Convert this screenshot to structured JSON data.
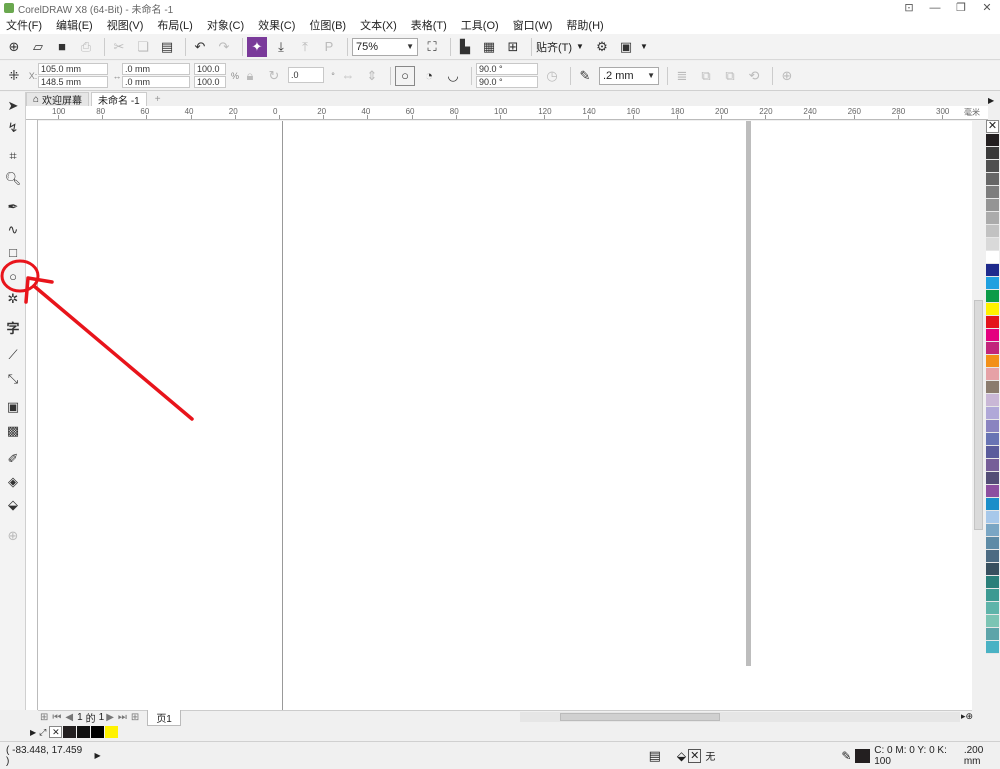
{
  "window": {
    "title": "CorelDRAW X8 (64-Bit) - 未命名 -1"
  },
  "menu": [
    "文件(F)",
    "编辑(E)",
    "视图(V)",
    "布局(L)",
    "对象(C)",
    "效果(C)",
    "位图(B)",
    "文本(X)",
    "表格(T)",
    "工具(O)",
    "窗口(W)",
    "帮助(H)"
  ],
  "standard_toolbar": {
    "zoom_value": "75%",
    "snap_label": "贴齐(T)"
  },
  "property_bar": {
    "x": "105.0 mm",
    "y": "148.5 mm",
    "width": ".0 mm",
    "height": ".0 mm",
    "scale_x": "100.0",
    "scale_y": "100.0",
    "percent": "%",
    "rotation": ".0",
    "angle_start": "90.0 °",
    "angle_end": "90.0 °",
    "outline_width": ".2 mm"
  },
  "tabs": {
    "welcome": "欢迎屏幕",
    "document": "未命名 -1"
  },
  "ruler": {
    "h_labels": [
      "100",
      "80",
      "60",
      "40",
      "20",
      "0",
      "20",
      "40",
      "60",
      "80",
      "100",
      "120",
      "140",
      "160",
      "180",
      "200",
      "220",
      "240",
      "260",
      "280",
      "300"
    ],
    "unit": "毫米"
  },
  "page_nav": {
    "current": "1",
    "of_label": "的",
    "total": "1",
    "page_tab": "页1"
  },
  "status": {
    "coords": "( -83.448, 17.459 )",
    "fill_label": "无",
    "outline_color": "C: 0 M: 0 Y: 0 K: 100",
    "outline_width": ".200 mm"
  },
  "palette_colors": [
    "#231f20",
    "#3a3a3a",
    "#505050",
    "#666666",
    "#7d7d7d",
    "#949494",
    "#ababab",
    "#c2c2c2",
    "#d9d9d9",
    "#ffffff",
    "#1e2a8c",
    "#1fa0df",
    "#0c9b48",
    "#fff200",
    "#e4141b",
    "#e4007f",
    "#c2257b",
    "#f39019",
    "#e6a1a6",
    "#8b7c6e",
    "#c9b7d6",
    "#b0a8d8",
    "#8a84c0",
    "#6874b4",
    "#5a5c9c",
    "#765e98",
    "#534d76",
    "#8c4fa0",
    "#1b8ec9",
    "#a7c8ea",
    "#7aa6c4",
    "#5e8ba6",
    "#4c6b82",
    "#38505f",
    "#2a7f7a",
    "#3d9a92",
    "#5fb4aa",
    "#7cc4b4",
    "#5da4a9",
    "#4ab2c4"
  ]
}
